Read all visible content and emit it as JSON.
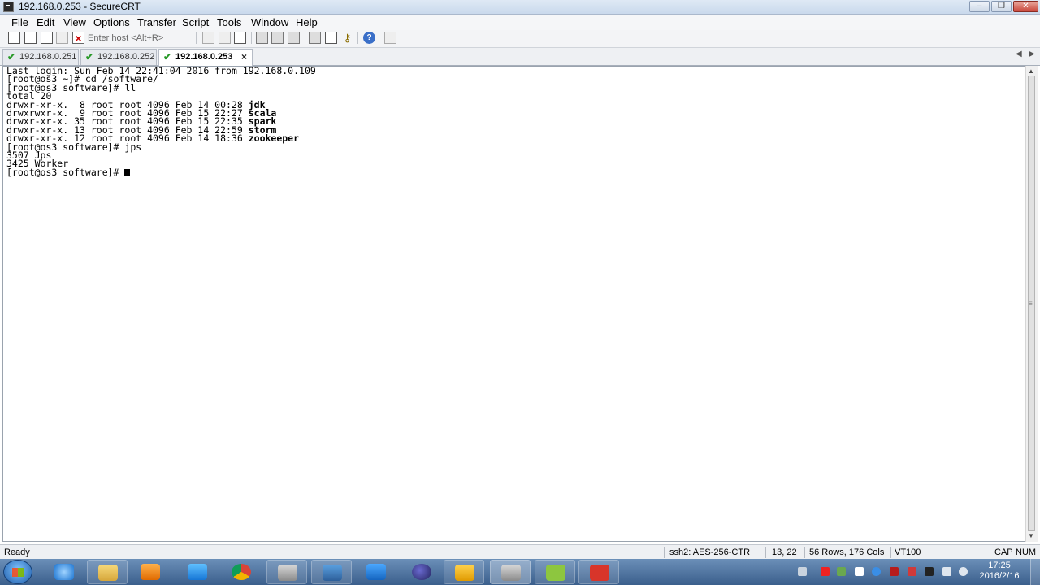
{
  "window": {
    "title": "192.168.0.253 - SecureCRT"
  },
  "window_buttons": {
    "minimize": "–",
    "restore": "❐",
    "close": "✕"
  },
  "menu": [
    "File",
    "Edit",
    "View",
    "Options",
    "Transfer",
    "Script",
    "Tools",
    "Window",
    "Help"
  ],
  "toolbar": {
    "host_placeholder": "Enter host <Alt+R>"
  },
  "tabs": [
    {
      "label": "192.168.0.251",
      "active": false
    },
    {
      "label": "192.168.0.252",
      "active": false
    },
    {
      "label": "192.168.0.253",
      "active": true
    }
  ],
  "tab_close": "×",
  "terminal": {
    "lines": [
      "Last login: Sun Feb 14 22:41:04 2016 from 192.168.0.109",
      "[root@os3 ~]# cd /software/",
      "[root@os3 software]# ll",
      "total 20"
    ],
    "listing": [
      {
        "perm": "drwxr-xr-x.  8 root root 4096 Feb 14 00:28 ",
        "name": "jdk"
      },
      {
        "perm": "drwxrwxr-x.  9 root root 4096 Feb 15 22:27 ",
        "name": "scala"
      },
      {
        "perm": "drwxr-xr-x. 35 root root 4096 Feb 15 22:35 ",
        "name": "spark"
      },
      {
        "perm": "drwxr-xr-x. 13 root root 4096 Feb 14 22:59 ",
        "name": "storm"
      },
      {
        "perm": "drwxr-xr-x. 12 root root 4096 Feb 14 18:36 ",
        "name": "zookeeper"
      }
    ],
    "after": [
      "[root@os3 software]# jps",
      "3507 Jps",
      "3425 Worker"
    ],
    "prompt": "[root@os3 software]# "
  },
  "status": {
    "ready": "Ready",
    "cipher": "ssh2: AES-256-CTR",
    "position": "13,  22",
    "size": "56 Rows, 176 Cols",
    "emulation": "VT100",
    "cap": "CAP",
    "num": "NUM"
  },
  "taskbar": {
    "apps": [
      "internet-explorer",
      "file-explorer",
      "media-player",
      "baidu-netdisk",
      "chrome",
      "securecrt",
      "lock-app",
      "pen-app",
      "eclipse",
      "virtualbox",
      "securecrt-active",
      "myeclipse",
      "wps"
    ],
    "clock_time": "17:25",
    "clock_date": "2016/2/16"
  }
}
